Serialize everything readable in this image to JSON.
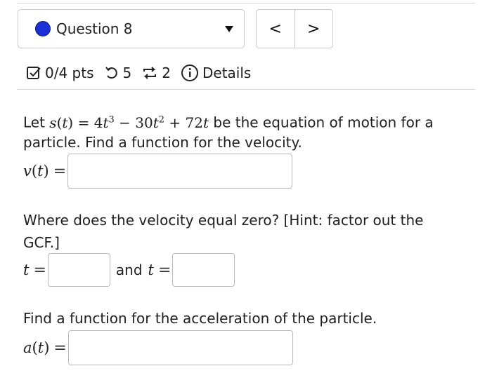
{
  "question": {
    "label": "Question 8",
    "dot_color": "#1b2fd6"
  },
  "nav": {
    "prev": "<",
    "next": ">"
  },
  "meta": {
    "points": "0/4 pts",
    "attempts": "5",
    "submissions": "2",
    "details": "Details"
  },
  "problem": {
    "intro_1": "Let ",
    "intro_2": " be the equation of motion for a",
    "intro_3": "particle. Find a function for the velocity.",
    "hint_1": "Where does the velocity equal zero? [Hint: factor out the",
    "hint_2": "GCF.]",
    "and_text": "and",
    "accel_text": "Find a function for the acceleration of the particle."
  },
  "answers": {
    "velocity": "",
    "t1": "",
    "t2": "",
    "acceleration": ""
  }
}
